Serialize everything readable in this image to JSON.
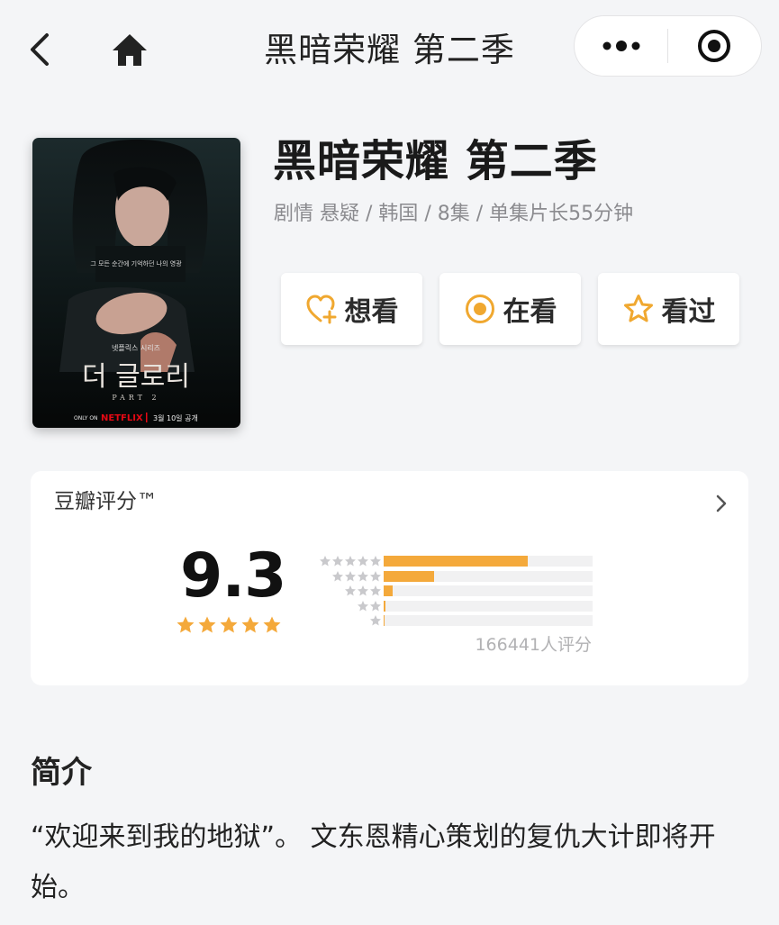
{
  "nav": {
    "title": "黑暗荣耀 第二季"
  },
  "poster": {
    "text_top": "그 모든 순간에 기억하던 나의 영광",
    "text_series": "넷플릭스 시리즈",
    "title_ko": "더 글로리",
    "part": "PART 2",
    "only_on": "ONLY ON",
    "brand": "NETFLIX",
    "date": "3월 10일 공개"
  },
  "movie": {
    "title": "黑暗荣耀 第二季",
    "meta": "剧情 悬疑 / 韩国 / 8集 / 单集片长55分钟"
  },
  "actions": {
    "want": "想看",
    "watching": "在看",
    "watched": "看过"
  },
  "rating": {
    "header": "豆瓣评分™",
    "score": "9.3",
    "count": "166441人评分",
    "distribution": [
      0.69,
      0.24,
      0.045,
      0.008,
      0.004
    ],
    "accent": "#f4a93b"
  },
  "intro": {
    "title": "简介",
    "text": "“欢迎来到我的地狱”。 文东恩精心策划的复仇大计即将开始。"
  }
}
